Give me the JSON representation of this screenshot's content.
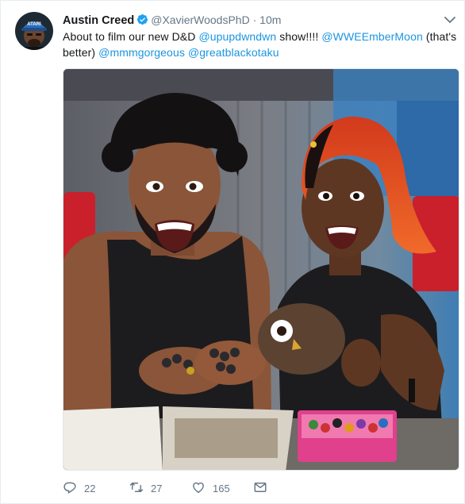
{
  "author": {
    "name": "Austin Creed",
    "handle": "@XavierWoodsPhD",
    "separator": "·",
    "time": "10m",
    "avatar_cap_text": "ATARI"
  },
  "tweet": {
    "text_1": "About to film our new D&D ",
    "mention_1": "@upupdwndwn",
    "text_2": " show!!!! ",
    "mention_2": "@WWEEmberMoon",
    "text_3": " (that's better) ",
    "mention_3": "@mmmgorgeous",
    "text_4": " ",
    "mention_4": "@greatblackotaku"
  },
  "actions": {
    "replies": "22",
    "retweets": "27",
    "likes": "165"
  },
  "colors": {
    "link": "#1b95e0",
    "verified": "#1da1f2",
    "muted": "#657786"
  },
  "icons": [
    "verified-badge-icon",
    "chevron-down-icon",
    "reply-icon",
    "retweet-icon",
    "like-icon",
    "direct-message-icon"
  ]
}
